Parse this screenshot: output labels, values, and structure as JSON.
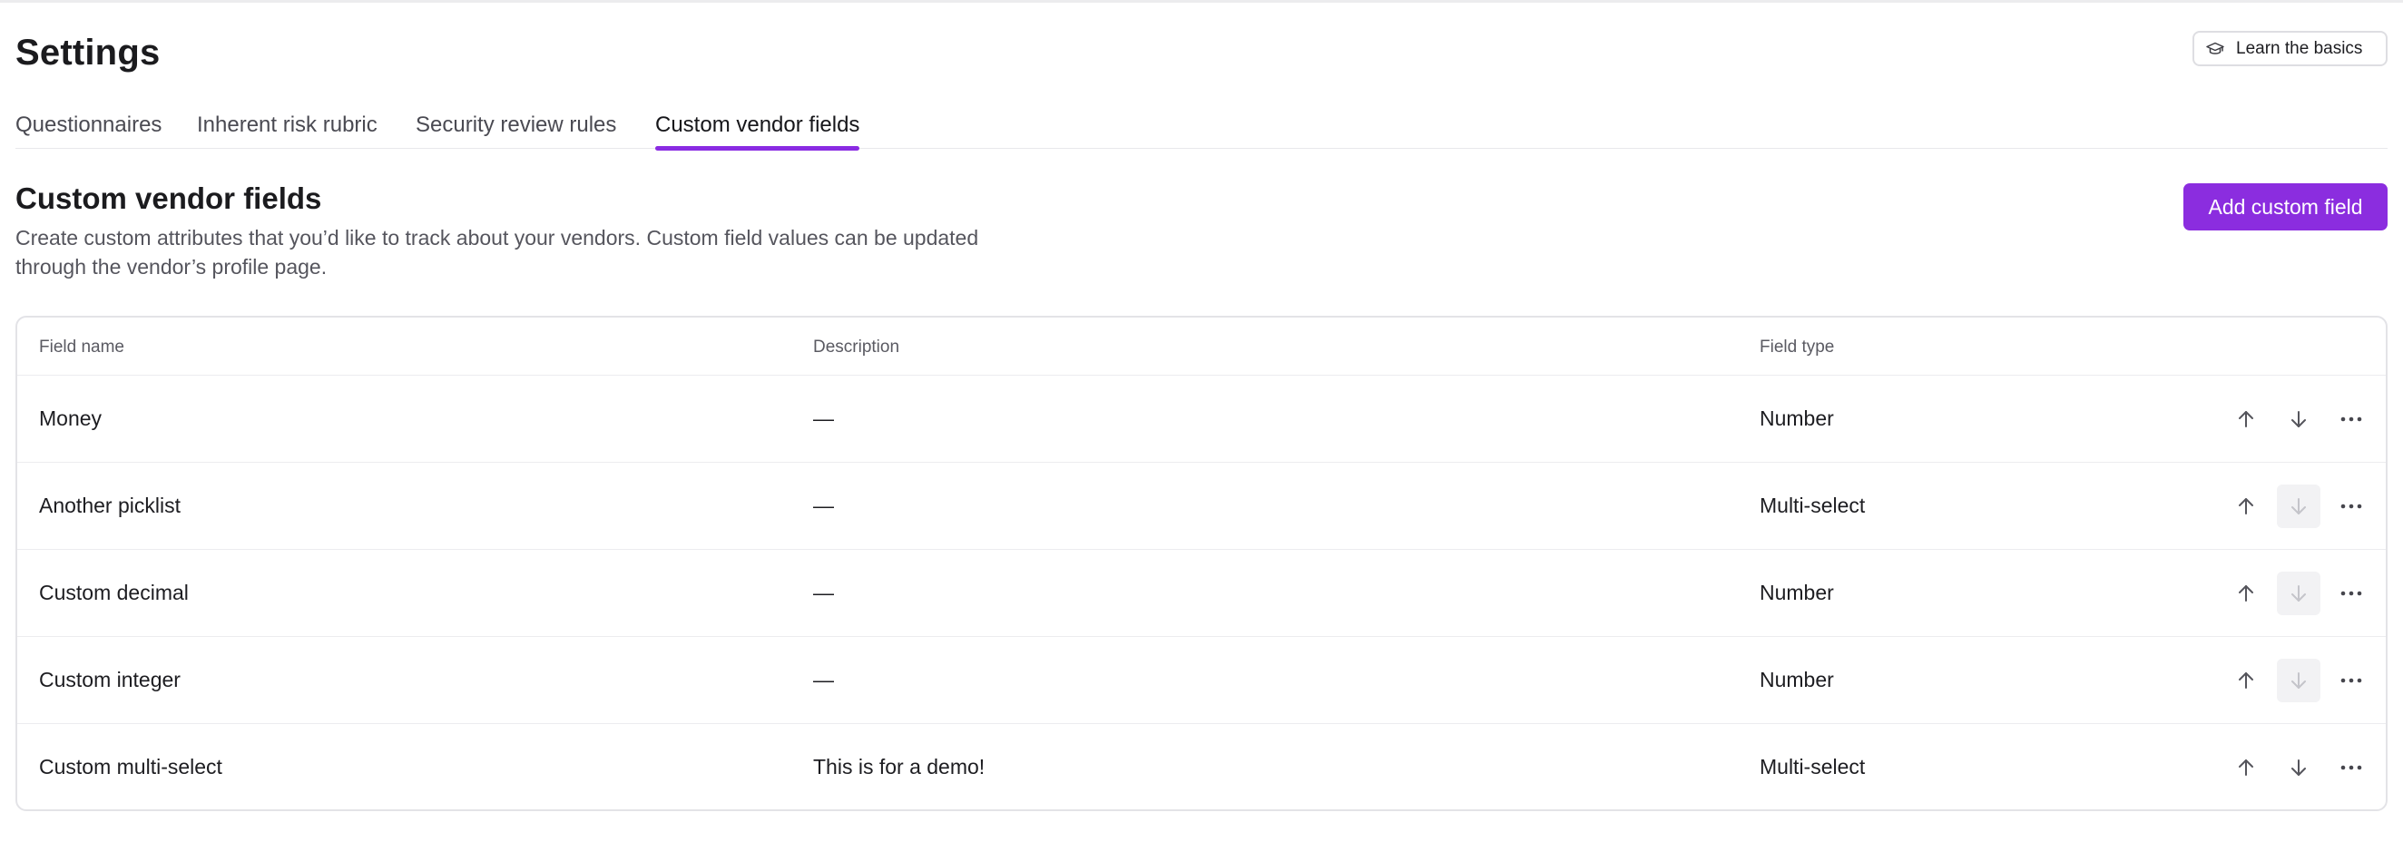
{
  "header": {
    "title": "Settings",
    "learn_button": "Learn the basics"
  },
  "tabs": [
    {
      "label": "Questionnaires"
    },
    {
      "label": "Inherent risk rubric"
    },
    {
      "label": "Security review rules"
    },
    {
      "label": "Custom vendor fields",
      "active": true
    }
  ],
  "section": {
    "title": "Custom vendor fields",
    "description": "Create custom attributes that you’d like to track about your vendors. Custom field values can be updated through the vendor’s profile page.",
    "add_button": "Add custom field"
  },
  "table": {
    "columns": {
      "name": "Field name",
      "description": "Description",
      "type": "Field type"
    },
    "rows": [
      {
        "name": "Money",
        "description": "—",
        "type": "Number",
        "down_disabled": false
      },
      {
        "name": "Another picklist",
        "description": "—",
        "type": "Multi-select",
        "down_disabled": true
      },
      {
        "name": "Custom decimal",
        "description": "—",
        "type": "Number",
        "down_disabled": true
      },
      {
        "name": "Custom integer",
        "description": "—",
        "type": "Number",
        "down_disabled": true
      },
      {
        "name": "Custom multi-select",
        "description": "This is for a demo!",
        "type": "Multi-select",
        "down_disabled": false
      }
    ]
  },
  "colors": {
    "accent": "#8b2ddf",
    "tab_underline": "#8a2be2"
  },
  "icons": {
    "learn": "graduation-cap-icon",
    "up": "arrow-up-icon",
    "down": "arrow-down-icon",
    "more": "more-horizontal-icon"
  }
}
